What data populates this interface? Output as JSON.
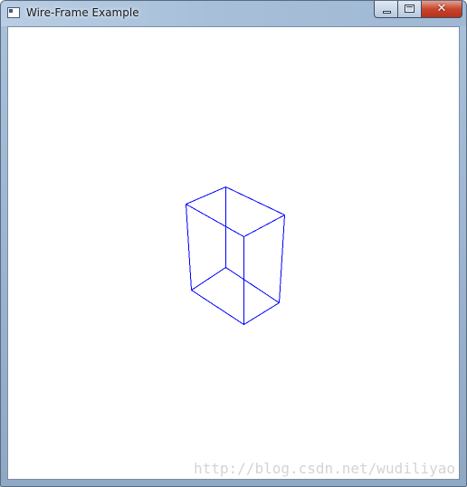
{
  "window": {
    "title": "Wire-Frame Example",
    "close_glyph": "✕"
  },
  "canvas": {
    "background": "#ffffff",
    "line_color": "#0000ff",
    "shape": "wireframe-box"
  },
  "watermark": {
    "text": "http://blog.csdn.net/wudiliyao"
  }
}
